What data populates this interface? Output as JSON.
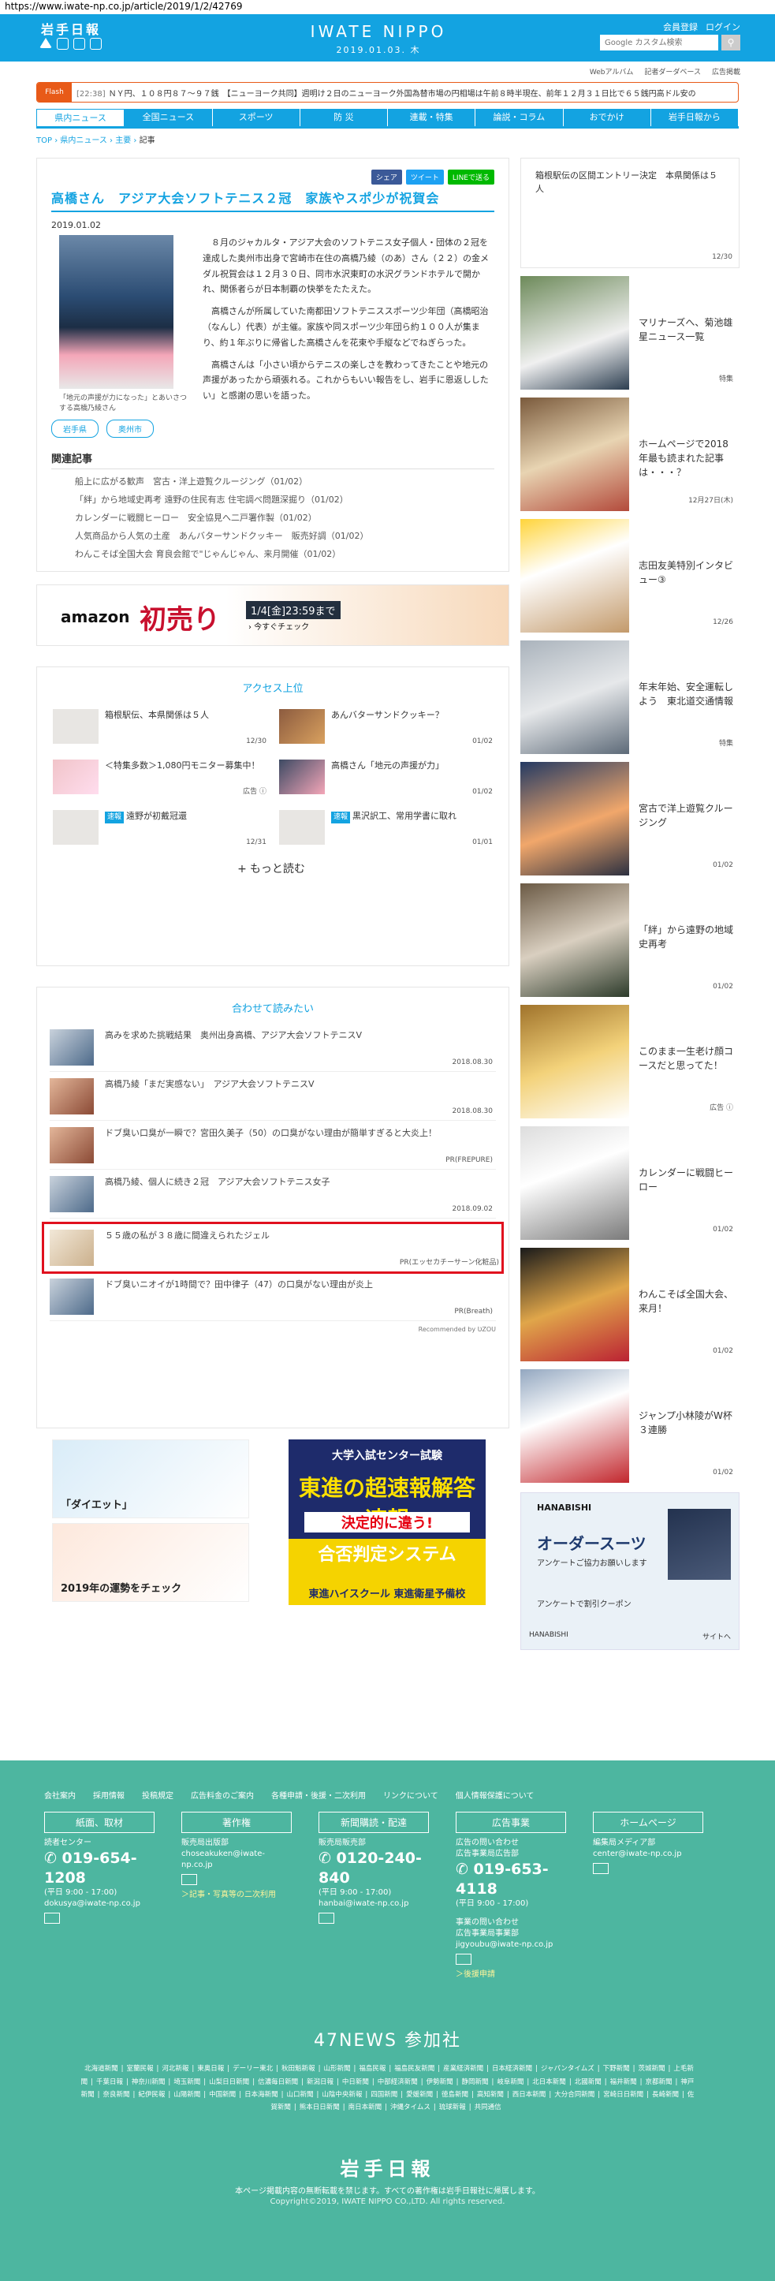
{
  "browser": {
    "url": "https://www.iwate-np.co.jp/article/2019/1/2/42769"
  },
  "header": {
    "logo": "岩手日報",
    "brand": "IWATE NIPPO",
    "date": "2019.01.03. 木",
    "member_register": "会員登録",
    "login": "ログイン",
    "search_placeholder": "Google カスタム検索",
    "subnav": [
      "Webアルバム",
      "記者ダーダベース",
      "広告掲載"
    ]
  },
  "flash": {
    "label": "Flash",
    "time": "[22:38]",
    "text": "ＮＹ円、１０８円８７～９７銭　【ニューヨーク共同】週明け２日のニューヨーク外国為替市場の円相場は午前８時半現在、前年１２月３１日比で６５銭円高ドル安の"
  },
  "gnav": [
    "県内ニュース",
    "全国ニュース",
    "スポーツ",
    "防 災",
    "連載・特集",
    "論説・コラム",
    "おでかけ",
    "岩手日報から"
  ],
  "breadcrumb": {
    "items": [
      "TOP",
      "県内ニュース",
      "主要"
    ],
    "current": "記事"
  },
  "article": {
    "share": {
      "facebook": "シェア",
      "twitter": "ツイート",
      "line": "LINEで送る"
    },
    "title": "高橋さん　アジア大会ソフトテニス２冠　家族やスポ少が祝賀会",
    "date": "2019.01.02",
    "caption": "「地元の声援が力になった」とあいさつする高橋乃綾さん",
    "paragraphs": [
      "８月のジャカルタ・アジア大会のソフトテニス女子個人・団体の２冠を達成した奥州市出身で宮崎市在住の高橋乃綾（のあ）さん（２２）の金メダル祝賀会は１２月３０日、同市水沢東町の水沢グランドホテルで開かれ、関係者らが日本制覇の快挙をたたえた。",
      "高橋さんが所属していた南都田ソフトテニススポーツ少年団（高橋昭治（なんし）代表）が主催。家族や同スポーツ少年団ら約１００人が集まり、約１年ぶりに帰省した高橋さんを花束や手縦などでねぎらった。",
      "高橋さんは「小さい頃からテニスの楽しさを教わってきたことや地元の声援があったから頑張れる。これからもいい報告をし、岩手に恩返ししたい」と感謝の思いを語った。"
    ],
    "tags": [
      "岩手県",
      "奥州市"
    ],
    "related_heading": "関連記事",
    "related": [
      "船上に広がる歓声　宮古・洋上遊覧クルージング（01/02）",
      "「絆」から地域史再考 遠野の住民有志 住宅調べ問題深掘り（01/02）",
      "カレンダーに戦闘ヒーロー　安全協見へ二戸署作製（01/02）",
      "人気商品から人気の土産　あんバターサンドクッキー　販売好調（01/02）",
      "わんこそば全国大会 育良会館で\"じゃんじゃん、来月開催（01/02）"
    ]
  },
  "ad_amazon": {
    "brand": "amazon",
    "headline": "初売り",
    "countdown": "1/4[金]23:59まで",
    "cta": "› 今すぐチェック"
  },
  "ranking": {
    "title": "アクセス上位",
    "items": [
      {
        "title": "箱根駅伝、本県関係は５人",
        "date": "12/30",
        "badge": ""
      },
      {
        "title": "あんバターサンドクッキー？",
        "date": "01/02",
        "badge": ""
      },
      {
        "title": "＜特集多数＞1,080円モニター募集中！",
        "date": "広告 ⓘ",
        "badge": ""
      },
      {
        "title": "高橋さん「地元の声援が力」",
        "date": "01/02",
        "badge": ""
      },
      {
        "title": "遠野が初戴冠還",
        "date": "12/31",
        "badge": "速報"
      },
      {
        "title": "黒沢訳工、常用学書に取れ",
        "date": "01/01",
        "badge": "速報"
      }
    ],
    "more": "もっと読む"
  },
  "recommend": {
    "title": "合わせて読みたい",
    "items": [
      {
        "title": "高みを求めた挑戦結果　奥州出身高橋、アジア大会ソフトテニスV",
        "date": "2018.08.30"
      },
      {
        "title": "高橋乃綾「まだ実感ない」　アジア大会ソフトテニスV",
        "date": "2018.08.30"
      },
      {
        "title": "ドブ臭い口臭が一瞬で？宮田久美子（50）の口臭がない理由が簡単すぎると大炎上！",
        "date": "PR(FREPURE)"
      },
      {
        "title": "高橋乃綾、個人に続き２冠　アジア大会ソフトテニス女子",
        "date": "2018.09.02"
      },
      {
        "title": "５５歳の私が３８歳に間違えられたジェル",
        "date": "PR(エッセカチーサーン化粧品)"
      },
      {
        "title": "ドブ臭いニオイが1時間で？田中律子（47）の口臭がない理由が炎上",
        "date": "PR(Breath)"
      }
    ],
    "by": "Recommended by ƲZOU"
  },
  "ad_fortune": {
    "top": "「ダイエット」",
    "bottom": "2019年の運勢をチェック"
  },
  "ad_school": {
    "l1": "大学入試センター試験",
    "l2": "東進の超速報解答速報",
    "l3": "決定的に違う!",
    "l4": "合否判定システム",
    "l5": "東進ハイスクール 東進衛星予備校"
  },
  "sidebar": {
    "top": {
      "title": "箱根駅伝の区間エントリー決定　本県関係は５人",
      "date": "12/30"
    },
    "items": [
      {
        "title": "マリナーズへ、菊池雄星ニュース一覧",
        "date": "特集"
      },
      {
        "title": "ホームページで2018年最も読まれた記事は・・・？",
        "date": "12月27日(木)"
      },
      {
        "title": "志田友美特別インタビュー③",
        "date": "12/26"
      },
      {
        "title": "年末年始、安全運転しよう　東北道交通情報",
        "date": "特集"
      },
      {
        "title": "宮古で洋上遊覧クルージング",
        "date": "01/02"
      },
      {
        "title": "「絆」から遠野の地域史再考",
        "date": "01/02"
      },
      {
        "title": "このまま一生老け顔コースだと思ってた！",
        "date": "広告 ⓘ"
      },
      {
        "title": "カレンダーに戦闘ヒーロー",
        "date": "01/02"
      },
      {
        "title": "わんこそば全国大会、来月！",
        "date": "01/02"
      },
      {
        "title": "ジャンプ小林陵がW杯３連勝",
        "date": "01/02"
      }
    ],
    "ad": {
      "brand": "HANABISHI",
      "headline": "オーダースーツ",
      "sub": "アンケートご協力お願いします",
      "coupon": "アンケートで割引クーポン",
      "foot_left": "HANABISHI",
      "foot_right": "サイトへ"
    }
  },
  "footer": {
    "nav": [
      "会社案内",
      "採用情報",
      "投稿規定",
      "広告料金のご案内",
      "各種申請・後援・二次利用",
      "リンクについて",
      "個人情報保護について"
    ],
    "boxes": [
      {
        "head": "紙面、取材",
        "lines": [
          "読者センター"
        ],
        "tel": "019-654-1208",
        "hours": "(平日 9:00 - 17:00)",
        "mail": "dokusya@iwate-np.co.jp",
        "link": ""
      },
      {
        "head": "著作権",
        "lines": [
          "販売局出版部"
        ],
        "tel": "",
        "hours": "",
        "mail": "choseakuken@iwate-np.co.jp",
        "link": "＞記事・写真等の二次利用"
      },
      {
        "head": "新聞購読・配達",
        "lines": [
          "販売局販売部"
        ],
        "tel": "0120-240-840",
        "hours": "(平日 9:00 - 17:00)",
        "mail": "hanbai@iwate-np.co.jp",
        "link": ""
      },
      {
        "head": "広告事業",
        "lines": [
          "広告の問い合わせ",
          "広告事業局広告部"
        ],
        "tel": "019-653-4118",
        "hours": "(平日 9:00 - 17:00)",
        "mail": "jigyoubu@iwate-np.co.jp",
        "link": "＞後援申請"
      },
      {
        "head": "ホームページ",
        "lines": [
          "編集局メディア部"
        ],
        "tel": "",
        "hours": "",
        "mail": "center@iwate-np.co.jp",
        "link": ""
      }
    ],
    "box4_extra": [
      "事業の問い合わせ",
      "広告事業局事業部"
    ],
    "news47": "47NEWS 参加社",
    "papers": [
      "北海道新聞",
      "室蘭民報",
      "河北新報",
      "東奥日報",
      "デーリー東北",
      "秋田魁新報",
      "山形新聞",
      "福島民報",
      "福島民友新聞",
      "産業経済新聞",
      "日本経済新聞",
      "ジャパンタイムズ",
      "下野新聞",
      "茨城新聞",
      "上毛新聞",
      "千葉日報",
      "神奈川新聞",
      "埼玉新聞",
      "山梨日日新聞",
      "信濃毎日新聞",
      "新潟日報",
      "中日新聞",
      "中部経済新聞",
      "伊勢新聞",
      "静岡新聞",
      "岐阜新聞",
      "北日本新聞",
      "北國新聞",
      "福井新聞",
      "京都新聞",
      "神戸新聞",
      "奈良新聞",
      "紀伊民報",
      "山陽新聞",
      "中国新聞",
      "日本海新聞",
      "山口新聞",
      "山陰中央新報",
      "四国新聞",
      "愛媛新聞",
      "徳島新聞",
      "高知新聞",
      "西日本新聞",
      "大分合同新聞",
      "宮崎日日新聞",
      "長崎新聞",
      "佐賀新聞",
      "熊本日日新聞",
      "南日本新聞",
      "沖縄タイムス",
      "琉球新報",
      "共同通信"
    ],
    "logo": "岩手日報",
    "notice": "本ページ掲載内容の無断転載を禁じます。すべての著作権は岩手日報社に帰属します。",
    "copyright": "Copyright©2019, IWATE NIPPO CO.,LTD. All rights reserved."
  },
  "colors": {
    "brand": "#13a3e1",
    "footer": "#4db6a0",
    "flash": "#e85a18",
    "highlight": "#e0101e"
  }
}
